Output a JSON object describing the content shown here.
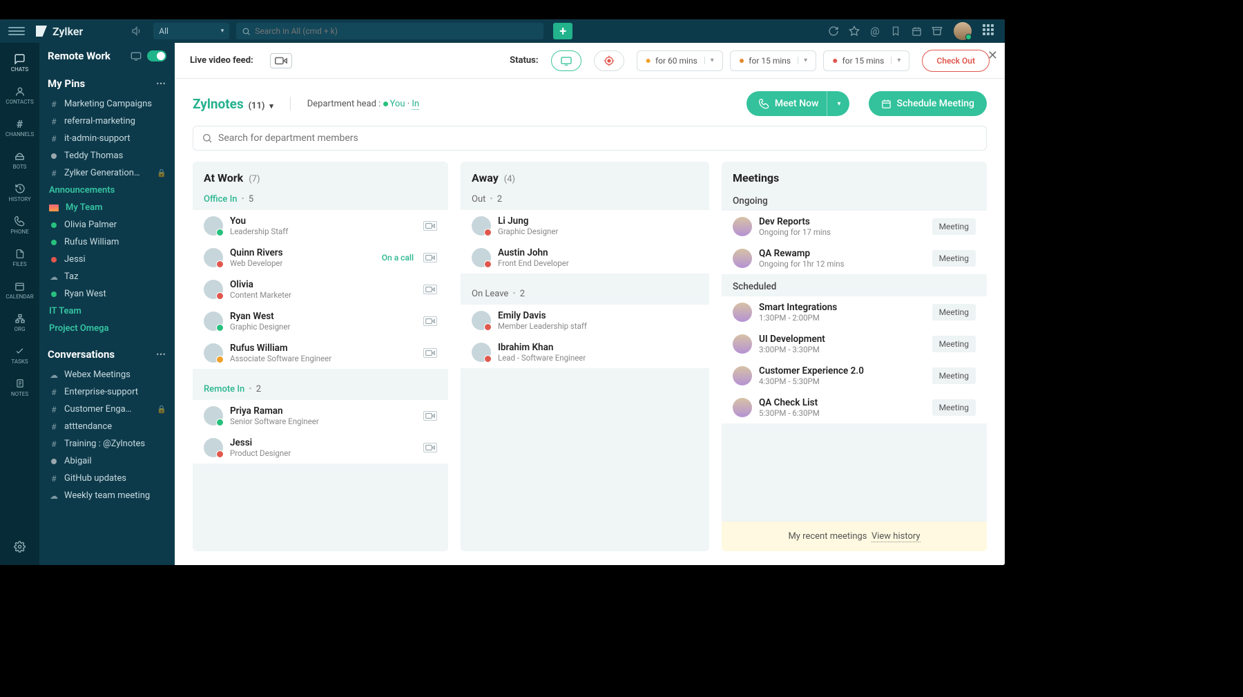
{
  "brand": "Zylker",
  "topbar": {
    "scope": "All",
    "search_placeholder": "Search in All (cmd + k)"
  },
  "rail": [
    {
      "id": "chats",
      "label": "CHATS"
    },
    {
      "id": "contacts",
      "label": "CONTACTS"
    },
    {
      "id": "channels",
      "label": "CHANNELS"
    },
    {
      "id": "bots",
      "label": "BOTS"
    },
    {
      "id": "history",
      "label": "HISTORY"
    },
    {
      "id": "phone",
      "label": "PHONE"
    },
    {
      "id": "files",
      "label": "FILES"
    },
    {
      "id": "calendar",
      "label": "CALENDAR"
    },
    {
      "id": "org",
      "label": "ORG"
    },
    {
      "id": "tasks",
      "label": "TASKS"
    },
    {
      "id": "notes",
      "label": "NOTES"
    }
  ],
  "sidebar": {
    "header": "Remote Work",
    "pins_title": "My Pins",
    "pins": [
      {
        "type": "hash",
        "label": "Marketing Campaigns"
      },
      {
        "type": "hash",
        "label": "referral-marketing"
      },
      {
        "type": "hash",
        "label": "it-admin-support"
      },
      {
        "type": "dot",
        "color": "#9aa8ad",
        "label": "Teddy Thomas"
      },
      {
        "type": "hash",
        "label": "Zylker Generation…",
        "locked": true
      }
    ],
    "announcements": "Announcements",
    "myteam": "My Team",
    "team": [
      {
        "color": "#27c07d",
        "label": "Olivia Palmer"
      },
      {
        "color": "#27c07d",
        "label": "Rufus William"
      },
      {
        "color": "#e0574d",
        "label": "Jessi"
      },
      {
        "type": "cloud",
        "label": "Taz"
      },
      {
        "color": "#27c07d",
        "label": "Ryan West"
      }
    ],
    "itteam": "IT Team",
    "project": "Project Omega",
    "conv_title": "Conversations",
    "conv": [
      {
        "type": "cloud",
        "label": "Webex Meetings"
      },
      {
        "type": "hash",
        "label": "Enterprise-support"
      },
      {
        "type": "hash",
        "label": "Customer Enga…",
        "locked": true
      },
      {
        "type": "hash",
        "label": "atttendance"
      },
      {
        "type": "hash",
        "label": "Training : @Zylnotes"
      },
      {
        "type": "dot",
        "color": "#9aa8ad",
        "label": "Abigail"
      },
      {
        "type": "hash",
        "label": "GitHub updates"
      },
      {
        "type": "cloud",
        "label": "Weekly team meeting"
      }
    ]
  },
  "status": {
    "live_label": "Live video feed:",
    "status_label": "Status:",
    "away_options": [
      {
        "icon": "meal",
        "text": "for 60 mins"
      },
      {
        "icon": "coffee",
        "text": "for 15 mins"
      },
      {
        "icon": "stretch",
        "text": "for 15 mins"
      }
    ],
    "checkout": "Check Out"
  },
  "dept": {
    "name": "Zylnotes",
    "count": "(11)",
    "head_label": "Department head :",
    "you": "You",
    "in": "In",
    "meet_now": "Meet Now",
    "schedule": "Schedule Meeting",
    "search_placeholder": "Search for department members"
  },
  "cols": {
    "work": {
      "title": "At Work",
      "count": "(7)",
      "groups": [
        {
          "label": "Office In",
          "count": "5",
          "members": [
            {
              "name": "You",
              "role": "Leadership Staff",
              "badge": "g",
              "cam": true
            },
            {
              "name": "Quinn Rivers",
              "role": "Web Developer",
              "badge": "r",
              "status": "On a call",
              "cam": true
            },
            {
              "name": "Olivia",
              "role": "Content Marketer",
              "badge": "r",
              "cam": true
            },
            {
              "name": "Ryan West",
              "role": "Graphic Designer",
              "badge": "g",
              "cam": true
            },
            {
              "name": "Rufus William",
              "role": "Associate Software Engineer",
              "badge": "y",
              "cam": true
            }
          ]
        },
        {
          "label": "Remote In",
          "count": "2",
          "members": [
            {
              "name": "Priya Raman",
              "role": "Senior Software Engineer",
              "badge": "g",
              "cam": true
            },
            {
              "name": "Jessi",
              "role": "Product Designer",
              "badge": "r",
              "cam": true
            }
          ]
        }
      ]
    },
    "away": {
      "title": "Away",
      "count": "(4)",
      "groups": [
        {
          "label": "Out",
          "count": "2",
          "members": [
            {
              "name": "Li Jung",
              "role": "Graphic Designer",
              "badge": "r"
            },
            {
              "name": "Austin John",
              "role": "Front End Developer",
              "badge": "r"
            }
          ]
        },
        {
          "label": "On Leave",
          "count": "2",
          "members": [
            {
              "name": "Emily Davis",
              "role": "Member Leadership staff",
              "badge": "r"
            },
            {
              "name": "Ibrahim Khan",
              "role": "Lead - Software Engineer",
              "badge": "r"
            }
          ]
        }
      ]
    },
    "meet": {
      "title": "Meetings",
      "ongoing_label": "Ongoing",
      "ongoing": [
        {
          "name": "Dev Reports",
          "sub": "Ongoing for 17 mins"
        },
        {
          "name": "QA Rewamp",
          "sub": "Ongoing for 1hr 12 mins"
        }
      ],
      "scheduled_label": "Scheduled",
      "scheduled": [
        {
          "name": "Smart Integrations",
          "sub": "1:30PM - 2:00PM"
        },
        {
          "name": "UI Development",
          "sub": "3:00PM - 3:30PM"
        },
        {
          "name": "Customer Experience 2.0",
          "sub": "4:30PM - 5:30PM"
        },
        {
          "name": "QA Check List",
          "sub": "5:30PM - 6:30PM"
        }
      ],
      "badge": "Meeting",
      "history_text": "My recent meetings",
      "history_link": "View history"
    }
  }
}
